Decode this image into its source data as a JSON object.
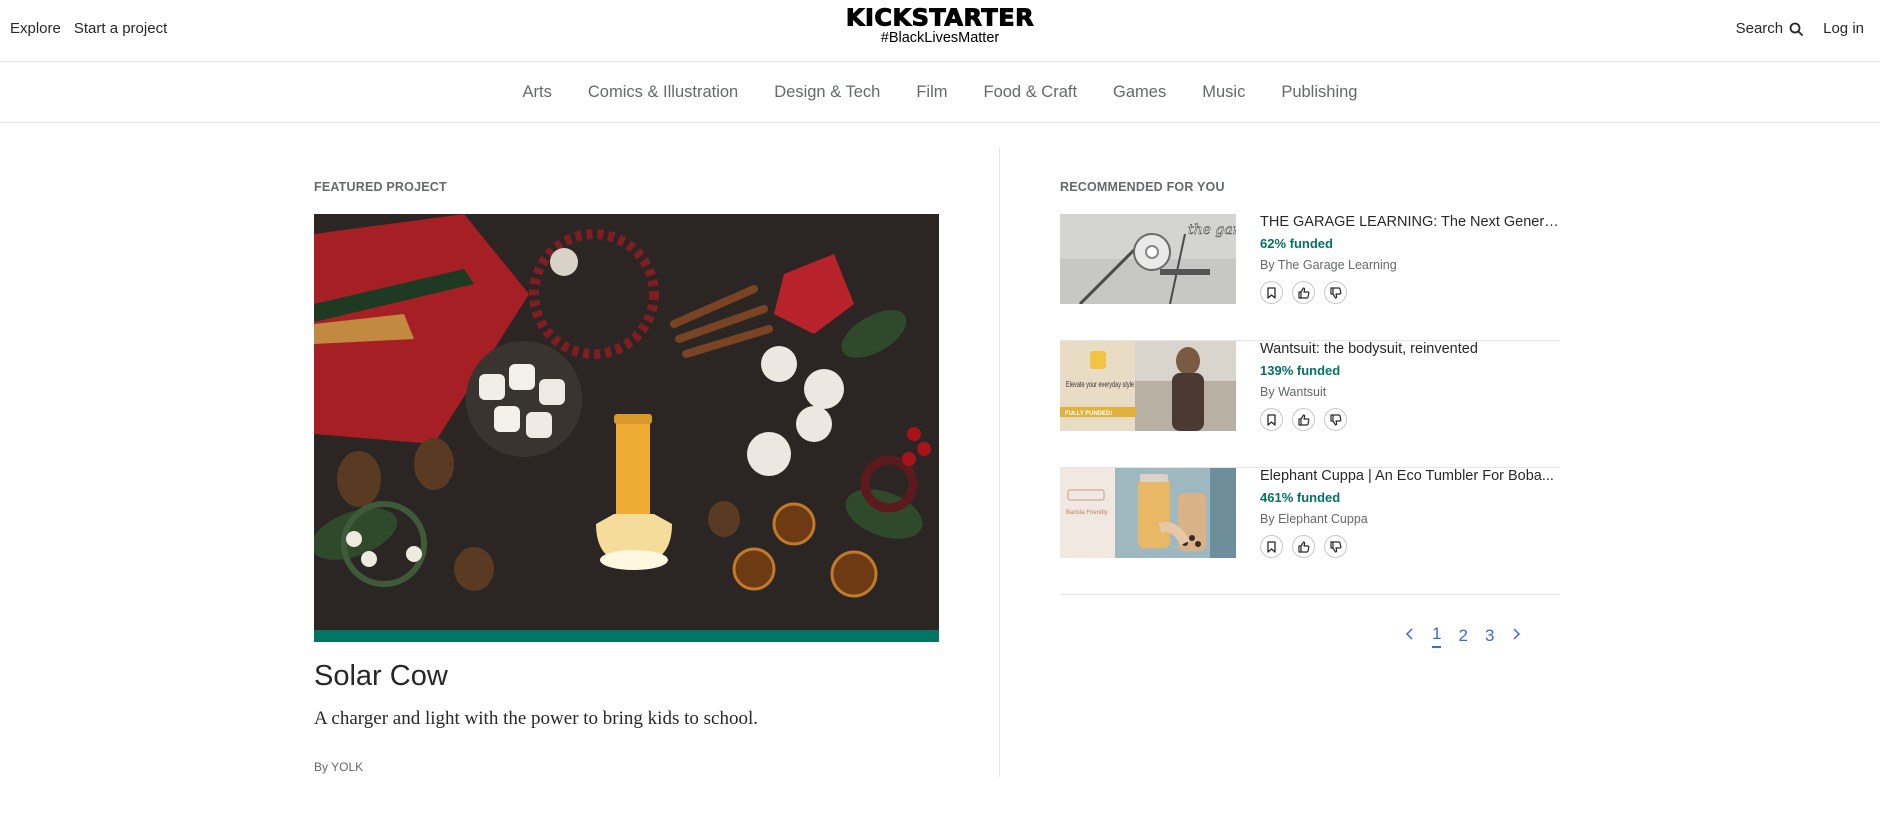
{
  "header": {
    "nav_left": [
      "Explore",
      "Start a project"
    ],
    "logo_text": "KICKSTARTER",
    "tagline": "#BlackLivesMatter",
    "search_label": "Search",
    "login_label": "Log in"
  },
  "categories": [
    "Arts",
    "Comics & Illustration",
    "Design & Tech",
    "Film",
    "Food & Craft",
    "Games",
    "Music",
    "Publishing"
  ],
  "featured": {
    "section_label": "FEATURED PROJECT",
    "title": "Solar Cow",
    "blurb": "A charger and light with the power to bring kids to school.",
    "by_prefix": "By",
    "creator": "YOLK"
  },
  "recommended": {
    "section_label": "RECOMMENDED FOR YOU",
    "items": [
      {
        "title": "THE GARAGE LEARNING: The Next Generatio...",
        "funded": "62% funded",
        "by_prefix": "By",
        "creator": "The Garage Learning",
        "thumb_text": "the garage"
      },
      {
        "title": "Wantsuit: the bodysuit, reinvented",
        "funded": "139% funded",
        "by_prefix": "By",
        "creator": "Wantsuit",
        "thumb_text": "Elevate your everyday style",
        "thumb_badge": "FULLY FUNDED!"
      },
      {
        "title": "Elephant Cuppa | An Eco Tumbler For Boba...",
        "funded": "461% funded",
        "by_prefix": "By",
        "creator": "Elephant Cuppa",
        "thumb_text": "Barista Friendly"
      }
    ]
  },
  "pagination": {
    "pages": [
      "1",
      "2",
      "3"
    ],
    "current": "1"
  },
  "colors": {
    "funded_green": "#037362",
    "link_blue": "#3b68e8",
    "muted_gray": "#656969",
    "text": "#282828"
  },
  "icons": [
    "search-icon",
    "bookmark-icon",
    "thumbs-up-icon",
    "thumbs-down-icon",
    "chevron-left-icon",
    "chevron-right-icon"
  ]
}
